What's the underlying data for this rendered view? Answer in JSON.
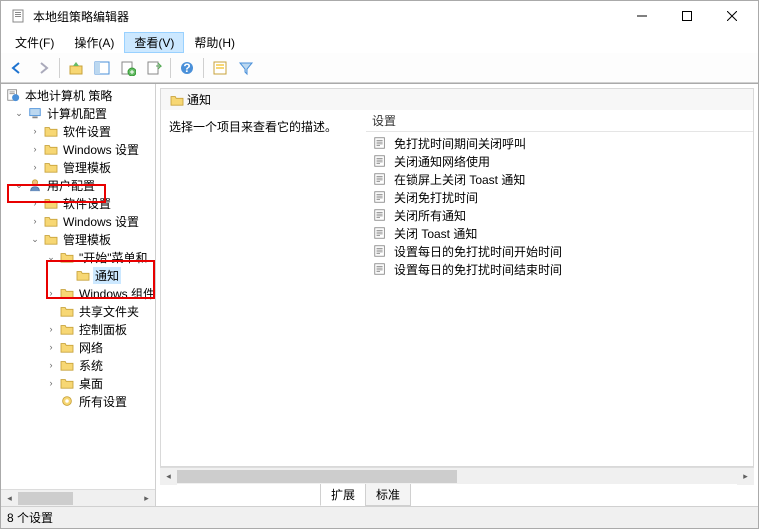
{
  "window": {
    "title": "本地组策略编辑器"
  },
  "menubar": {
    "file": "文件(F)",
    "action": "操作(A)",
    "view": "查看(V)",
    "help": "帮助(H)"
  },
  "tree": {
    "root": "本地计算机 策略",
    "computer_config": "计算机配置",
    "software_settings": "软件设置",
    "windows_settings": "Windows 设置",
    "admin_templates": "管理模板",
    "user_config": "用户配置",
    "software_settings2": "软件设置",
    "windows_settings2": "Windows 设置",
    "admin_templates2": "管理模板",
    "start_menu": "\"开始\"菜单和",
    "notifications": "通知",
    "windows_components": "Windows 组件",
    "shared_folders": "共享文件夹",
    "control_panel": "控制面板",
    "network": "网络",
    "system": "系统",
    "desktop": "桌面",
    "all_settings": "所有设置"
  },
  "header": {
    "folder_title": "通知"
  },
  "desc": {
    "text": "选择一个项目来查看它的描述。"
  },
  "list": {
    "col_setting": "设置",
    "items": [
      "免打扰时间期间关闭呼叫",
      "关闭通知网络使用",
      "在锁屏上关闭 Toast 通知",
      "关闭免打扰时间",
      "关闭所有通知",
      "关闭 Toast 通知",
      "设置每日的免打扰时间开始时间",
      "设置每日的免打扰时间结束时间"
    ]
  },
  "tabs": {
    "extended": "扩展",
    "standard": "标准"
  },
  "status": {
    "count": "8 个设置"
  }
}
